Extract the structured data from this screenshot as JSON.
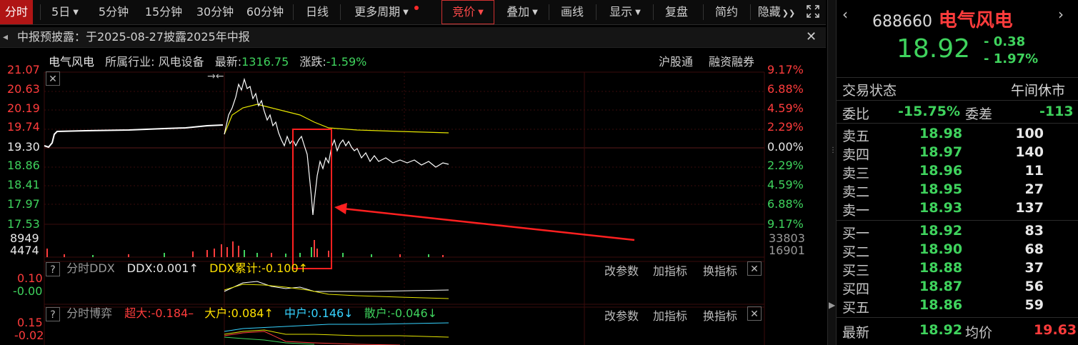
{
  "toolbar": {
    "fenshi": "分时",
    "wuri": "5日",
    "m5": "5分钟",
    "m15": "15分钟",
    "m30": "30分钟",
    "m60": "60分钟",
    "day": "日线",
    "more": "更多周期",
    "jingjia": "竞价",
    "diejia": "叠加",
    "huaxian": "画线",
    "xianshi": "显示",
    "fupan": "复盘",
    "jianyue": "简约",
    "yincang": "隐藏"
  },
  "notice": {
    "text": "中报预披露：于2025-08-27披露2025年中报"
  },
  "info": {
    "name": "电气风电",
    "industry": "所属行业: 风电设备",
    "latest_label": "最新:",
    "latest_value": "1316.75",
    "change_label": "涨跌:",
    "change_value": "-1.59%",
    "hgt": "沪股通",
    "rzrq": "融资融券"
  },
  "price_axis": {
    "left": [
      "21.07",
      "20.63",
      "20.19",
      "19.74",
      "19.30",
      "18.86",
      "18.41",
      "17.97",
      "17.53"
    ],
    "right": [
      "9.17%",
      "6.88%",
      "4.59%",
      "2.29%",
      "0.00%",
      "2.29%",
      "4.59%",
      "6.88%",
      "9.17%"
    ]
  },
  "volume_axis": {
    "left": [
      "8949",
      "4474"
    ],
    "right": [
      "33803",
      "16901"
    ]
  },
  "ddx": {
    "title": "分时DDX",
    "ddx_value": "DDX:0.001↑",
    "ddx_cum": "DDX累计:-0.100↑",
    "axis": [
      "0.10",
      "-0.00"
    ],
    "btn1": "改参数",
    "btn2": "加指标",
    "btn3": "换指标"
  },
  "boyi": {
    "title": "分时博弈",
    "chaoda": "超大:-0.184–",
    "dahu": "大户:0.084↑",
    "zhonghu": "中户:0.146↓",
    "sanhu": "散户:-0.046↓",
    "axis": [
      "0.15",
      "-0.02"
    ],
    "btn1": "改参数",
    "btn2": "加指标",
    "btn3": "换指标"
  },
  "quote": {
    "code": "688660",
    "name": "电气风电",
    "price": "18.92",
    "change": "- 0.38",
    "change_pct": "- 1.97%",
    "status_label": "交易状态",
    "status_value": "午间休市",
    "weibi_label": "委比",
    "weibi_value": "-15.75%",
    "weicha_label": "委差",
    "weicha_value": "-113",
    "sells": [
      {
        "label": "卖五",
        "price": "18.98",
        "vol": "100"
      },
      {
        "label": "卖四",
        "price": "18.97",
        "vol": "140"
      },
      {
        "label": "卖三",
        "price": "18.96",
        "vol": "11"
      },
      {
        "label": "卖二",
        "price": "18.95",
        "vol": "27"
      },
      {
        "label": "卖一",
        "price": "18.93",
        "vol": "137"
      }
    ],
    "buys": [
      {
        "label": "买一",
        "price": "18.92",
        "vol": "83"
      },
      {
        "label": "买二",
        "price": "18.90",
        "vol": "68"
      },
      {
        "label": "买三",
        "price": "18.88",
        "vol": "37"
      },
      {
        "label": "买四",
        "price": "18.87",
        "vol": "56"
      },
      {
        "label": "买五",
        "price": "18.86",
        "vol": "59"
      }
    ],
    "latest_label": "最新",
    "latest_value": "18.92",
    "avg_label": "均价",
    "avg_value": "19.63"
  },
  "colors": {
    "up": "#ff3c3c",
    "down": "#3fd35d",
    "accent": "#b01515",
    "avg": "#e6e600"
  }
}
